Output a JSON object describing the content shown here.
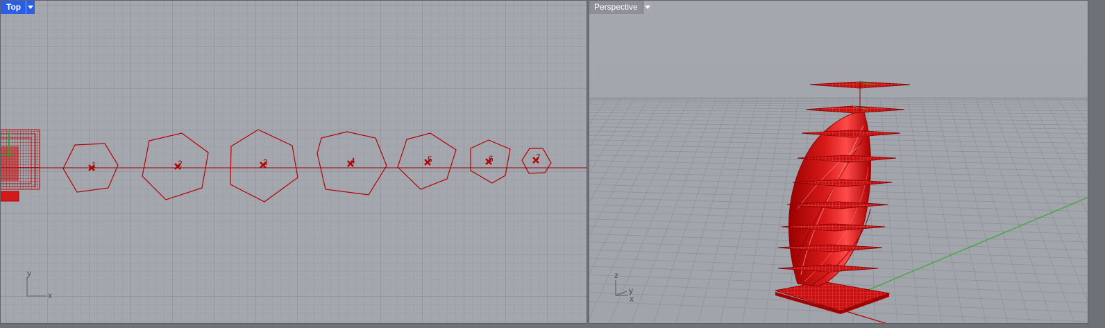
{
  "viewports": {
    "top": {
      "title": "Top",
      "axis_x": "x",
      "axis_y": "y",
      "point_labels": [
        "1",
        "2",
        "3",
        "4",
        "5",
        "6",
        "7"
      ]
    },
    "perspective": {
      "title": "Perspective",
      "axis_x": "x",
      "axis_y": "y",
      "axis_z": "z"
    }
  },
  "icons": {
    "dropdown": "chevron-down-icon",
    "point_marker": "x-marker-icon"
  },
  "colors": {
    "active_tab": "#2b5ee6",
    "viewport_bg": "#a4a8ae",
    "grid": "#8e9298",
    "geometry": "#c40000",
    "x_axis_line": "#9e0000",
    "green_axis": "#3fa63f"
  }
}
